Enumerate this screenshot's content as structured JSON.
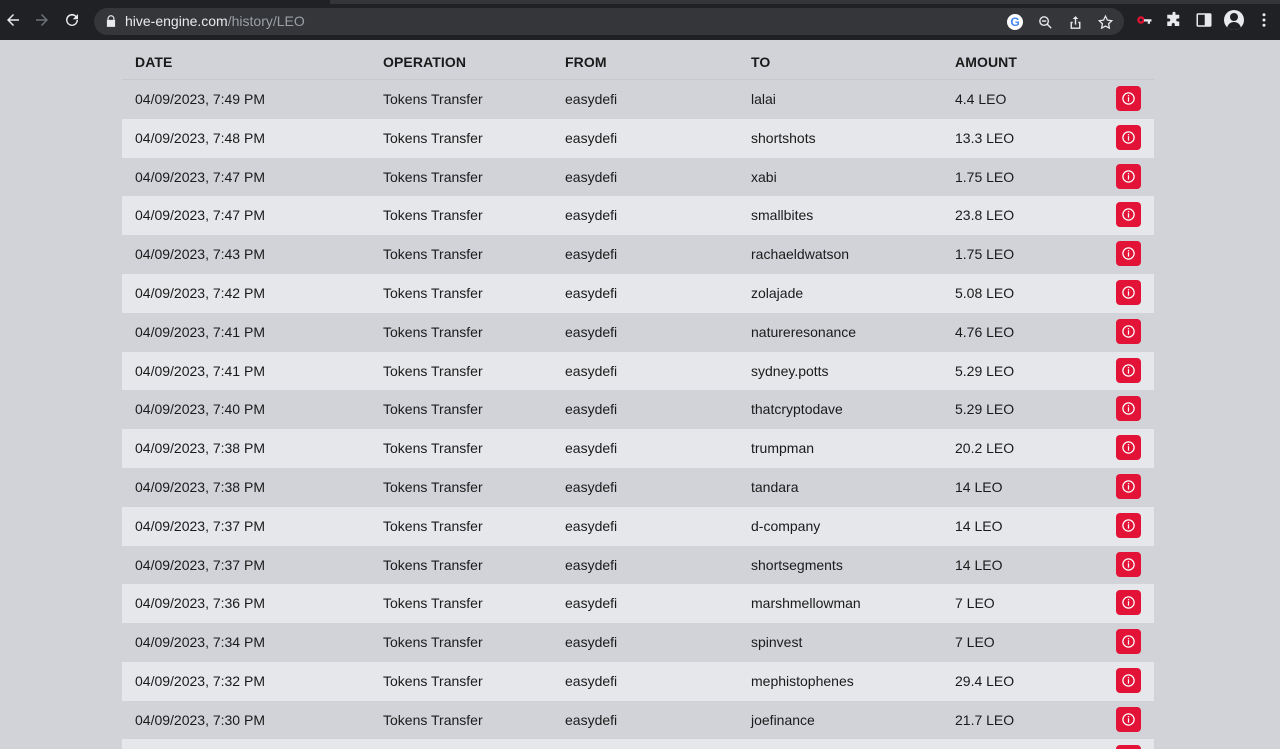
{
  "browser": {
    "url_host": "hive-engine.com",
    "url_path": "/history/LEO",
    "icons": [
      "back-icon",
      "forward-icon",
      "reload-icon",
      "lock-icon",
      "google-icon",
      "zoom-icon",
      "share-icon",
      "bookmark-star-icon",
      "extension-key-icon",
      "puzzle-icon",
      "side-panel-icon",
      "profile-icon",
      "menu-icon"
    ]
  },
  "table": {
    "headers": {
      "date": "DATE",
      "operation": "OPERATION",
      "from": "FROM",
      "to": "TO",
      "amount": "AMOUNT"
    },
    "rows": [
      {
        "date": "04/09/2023, 7:49 PM",
        "operation": "Tokens Transfer",
        "from": "easydefi",
        "to": "lalai",
        "amount": "4.4 LEO"
      },
      {
        "date": "04/09/2023, 7:48 PM",
        "operation": "Tokens Transfer",
        "from": "easydefi",
        "to": "shortshots",
        "amount": "13.3 LEO"
      },
      {
        "date": "04/09/2023, 7:47 PM",
        "operation": "Tokens Transfer",
        "from": "easydefi",
        "to": "xabi",
        "amount": "1.75 LEO"
      },
      {
        "date": "04/09/2023, 7:47 PM",
        "operation": "Tokens Transfer",
        "from": "easydefi",
        "to": "smallbites",
        "amount": "23.8 LEO"
      },
      {
        "date": "04/09/2023, 7:43 PM",
        "operation": "Tokens Transfer",
        "from": "easydefi",
        "to": "rachaeldwatson",
        "amount": "1.75 LEO"
      },
      {
        "date": "04/09/2023, 7:42 PM",
        "operation": "Tokens Transfer",
        "from": "easydefi",
        "to": "zolajade",
        "amount": "5.08 LEO"
      },
      {
        "date": "04/09/2023, 7:41 PM",
        "operation": "Tokens Transfer",
        "from": "easydefi",
        "to": "natureresonance",
        "amount": "4.76 LEO"
      },
      {
        "date": "04/09/2023, 7:41 PM",
        "operation": "Tokens Transfer",
        "from": "easydefi",
        "to": "sydney.potts",
        "amount": "5.29 LEO"
      },
      {
        "date": "04/09/2023, 7:40 PM",
        "operation": "Tokens Transfer",
        "from": "easydefi",
        "to": "thatcryptodave",
        "amount": "5.29 LEO"
      },
      {
        "date": "04/09/2023, 7:38 PM",
        "operation": "Tokens Transfer",
        "from": "easydefi",
        "to": "trumpman",
        "amount": "20.2 LEO"
      },
      {
        "date": "04/09/2023, 7:38 PM",
        "operation": "Tokens Transfer",
        "from": "easydefi",
        "to": "tandara",
        "amount": "14 LEO"
      },
      {
        "date": "04/09/2023, 7:37 PM",
        "operation": "Tokens Transfer",
        "from": "easydefi",
        "to": "d-company",
        "amount": "14 LEO"
      },
      {
        "date": "04/09/2023, 7:37 PM",
        "operation": "Tokens Transfer",
        "from": "easydefi",
        "to": "shortsegments",
        "amount": "14 LEO"
      },
      {
        "date": "04/09/2023, 7:36 PM",
        "operation": "Tokens Transfer",
        "from": "easydefi",
        "to": "marshmellowman",
        "amount": "7 LEO"
      },
      {
        "date": "04/09/2023, 7:34 PM",
        "operation": "Tokens Transfer",
        "from": "easydefi",
        "to": "spinvest",
        "amount": "7 LEO"
      },
      {
        "date": "04/09/2023, 7:32 PM",
        "operation": "Tokens Transfer",
        "from": "easydefi",
        "to": "mephistophenes",
        "amount": "29.4 LEO"
      },
      {
        "date": "04/09/2023, 7:30 PM",
        "operation": "Tokens Transfer",
        "from": "easydefi",
        "to": "joefinance",
        "amount": "21.7 LEO"
      }
    ]
  },
  "colors": {
    "info_button": "#e31337",
    "row_light": "#e6e7ea",
    "row_dark": "#d1d3d9",
    "chrome_bg": "#202124"
  }
}
